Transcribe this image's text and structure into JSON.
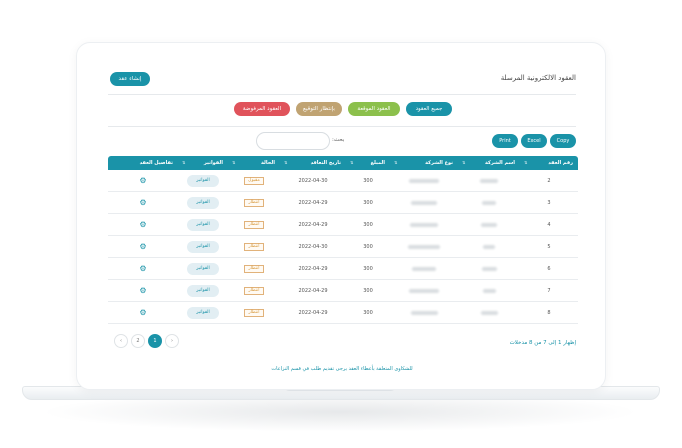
{
  "page": {
    "title": "العقود الالكترونية المرسلة",
    "create_button": "إنشاء عقد"
  },
  "filters": {
    "all": "جميع العقود",
    "signed": "العقود الموقعة",
    "waiting": "بإنتظار التوقيع",
    "rejected": "العقود المرفوضة"
  },
  "exports": {
    "print": "Print",
    "excel": "Excel",
    "copy": "Copy"
  },
  "search": {
    "label": "بحث:",
    "placeholder": ""
  },
  "table": {
    "headers": {
      "contract_no": "رقم العقد",
      "company_name": "اسم الشركة",
      "company_type": "نوع الشركة",
      "amount": "المبلغ",
      "contract_date": "تاريخ التعاقد",
      "status": "الحالة",
      "invoices": "الفواتير",
      "details": "تفاصيل العقد"
    },
    "rows": [
      {
        "no": "2",
        "amount": "300",
        "date": "2022-04-30",
        "status": "مقبول",
        "invoices": "الفواتير"
      },
      {
        "no": "3",
        "amount": "300",
        "date": "2022-04-29",
        "status": "انتظار",
        "invoices": "الفواتير"
      },
      {
        "no": "4",
        "amount": "300",
        "date": "2022-04-29",
        "status": "انتظار",
        "invoices": "الفواتير"
      },
      {
        "no": "5",
        "amount": "300",
        "date": "2022-04-30",
        "status": "انتظار",
        "invoices": "الفواتير"
      },
      {
        "no": "6",
        "amount": "300",
        "date": "2022-04-29",
        "status": "انتظار",
        "invoices": "الفواتير"
      },
      {
        "no": "7",
        "amount": "300",
        "date": "2022-04-29",
        "status": "انتظار",
        "invoices": "الفواتير"
      },
      {
        "no": "8",
        "amount": "300",
        "date": "2022-04-29",
        "status": "انتظار",
        "invoices": "الفواتير"
      }
    ]
  },
  "pagination": {
    "info": "إظهار 1 إلى 7 من 8 مدخلات",
    "pages": [
      "2",
      "1"
    ],
    "active_page": "1",
    "prev": "‹",
    "next": "›"
  },
  "footer_note": "للشكاوى المتعلقة بأعطاء العقد يرجى تقديم طلب في قسم النزاعات",
  "colors": {
    "accent": "#1a93a8",
    "signed": "#8cc04c",
    "waiting": "#c0a372",
    "rejected": "#e0535b"
  }
}
